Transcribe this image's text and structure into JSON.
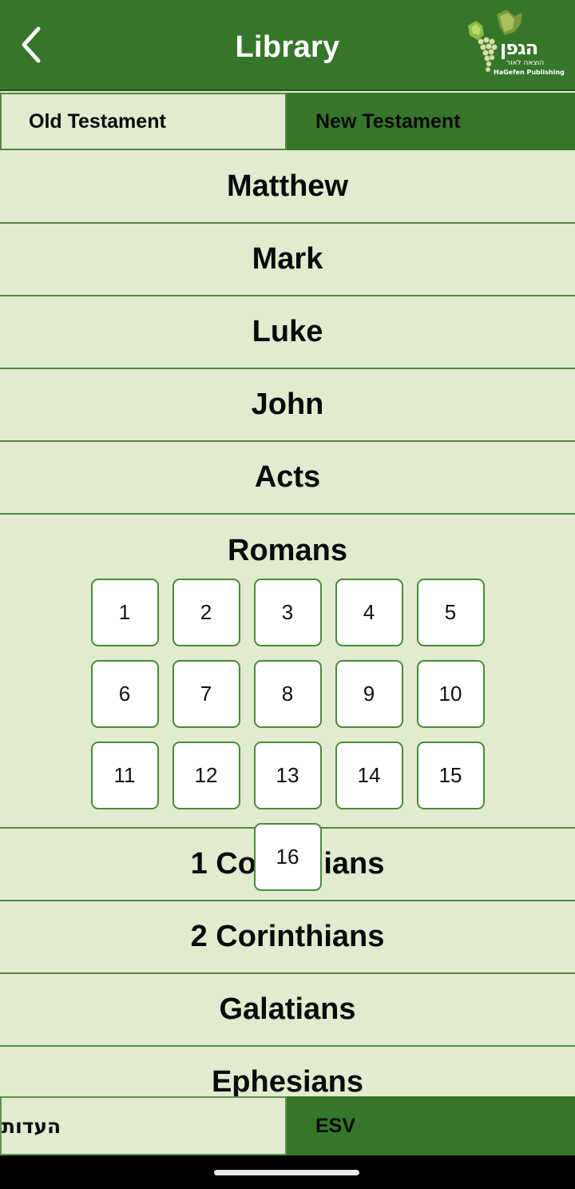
{
  "header": {
    "title": "Library",
    "back_icon": "chevron-left-icon",
    "logo": {
      "hebrew_name": "הגפן",
      "hebrew_subtitle": "הוצאה לאור",
      "english_name": "HaGefen Publishing"
    }
  },
  "testament_tabs": [
    {
      "label": "Old Testament",
      "selected": false
    },
    {
      "label": "New Testament",
      "selected": true
    }
  ],
  "books_before": [
    "Matthew",
    "Mark",
    "Luke",
    "John",
    "Acts"
  ],
  "expanded_book": {
    "name": "Romans",
    "chapters": [
      "1",
      "2",
      "3",
      "4",
      "5",
      "6",
      "7",
      "8",
      "9",
      "10",
      "11",
      "12",
      "13",
      "14",
      "15",
      "16"
    ]
  },
  "books_after": [
    "1 Corinthians",
    "2 Corinthians",
    "Galatians",
    "Ephesians"
  ],
  "version_tabs": [
    {
      "label": "העדות",
      "selected": false
    },
    {
      "label": "ESV",
      "selected": true
    }
  ],
  "colors": {
    "primary_green": "#36762a",
    "background": "#e1ebcf",
    "divider": "#4d8a3a",
    "chapter_bg": "#ffffff"
  }
}
